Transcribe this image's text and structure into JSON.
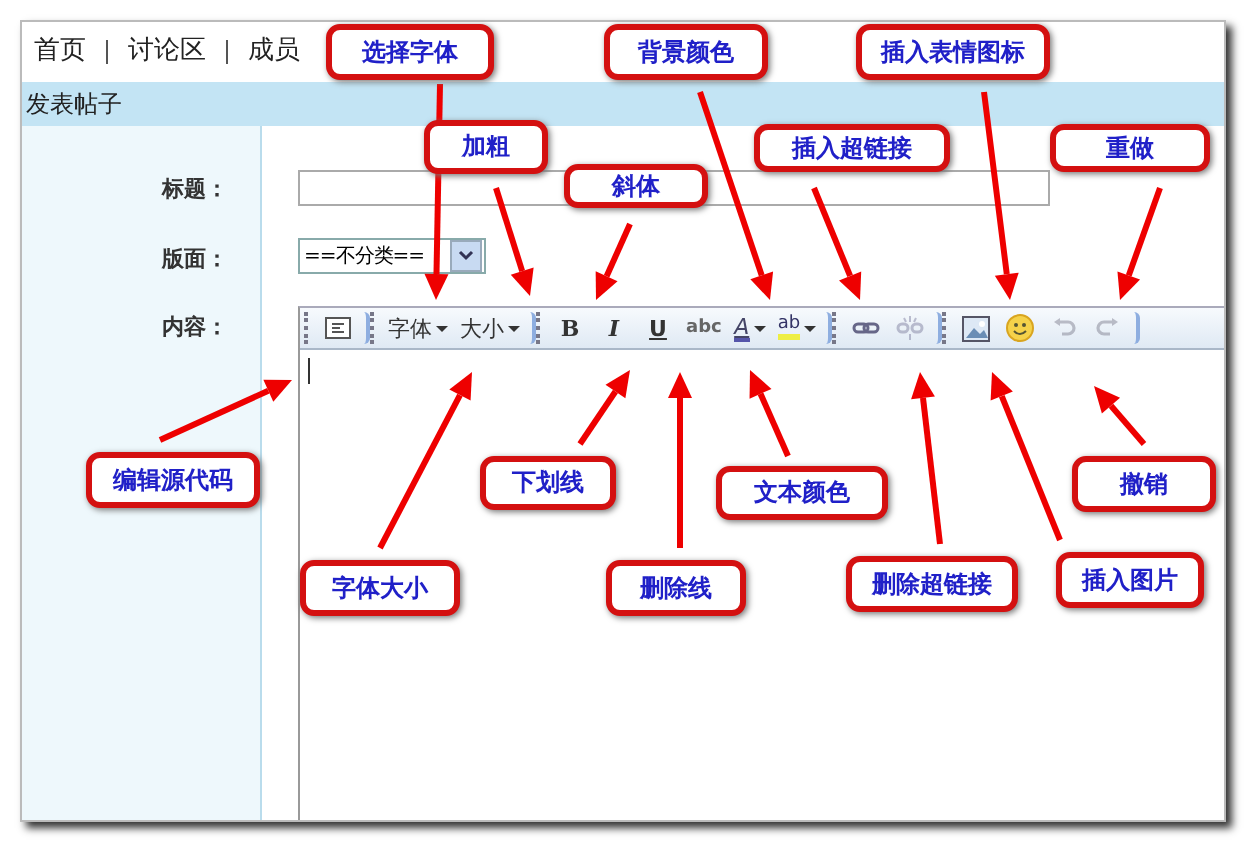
{
  "nav": [
    "首页",
    "讨论区",
    "成员"
  ],
  "header": {
    "title": "发表帖子"
  },
  "form": {
    "title_label": "标题：",
    "board_label": "版面：",
    "board_value": "==不分类==",
    "content_label": "内容："
  },
  "toolbar": {
    "groups": [
      [
        {
          "kind": "source",
          "disabled": false
        }
      ],
      [
        {
          "kind": "dropdown",
          "label": "字体",
          "disabled": false
        },
        {
          "kind": "dropdown",
          "label": "大小",
          "disabled": false
        }
      ],
      [
        {
          "kind": "bold",
          "label": "B",
          "disabled": false
        },
        {
          "kind": "italic",
          "label": "I",
          "disabled": false
        },
        {
          "kind": "underline",
          "label": "U",
          "disabled": false
        },
        {
          "kind": "strike",
          "label": "abc",
          "disabled": false
        },
        {
          "kind": "forecolor",
          "label": "A",
          "disabled": false
        },
        {
          "kind": "backcolor",
          "label": "ab",
          "disabled": false
        }
      ],
      [
        {
          "kind": "link",
          "disabled": false
        },
        {
          "kind": "unlink",
          "disabled": true
        }
      ],
      [
        {
          "kind": "image",
          "disabled": false
        },
        {
          "kind": "emoticon",
          "disabled": false
        },
        {
          "kind": "undo",
          "disabled": true
        },
        {
          "kind": "redo",
          "disabled": true
        }
      ]
    ]
  },
  "callouts": [
    "选择字体",
    "加粗",
    "斜体",
    "背景颜色",
    "插入超链接",
    "插入表情图标",
    "重做",
    "编辑源代码",
    "下划线",
    "文本颜色",
    "撤销",
    "字体大小",
    "删除线",
    "删除超链接",
    "插入图片"
  ]
}
